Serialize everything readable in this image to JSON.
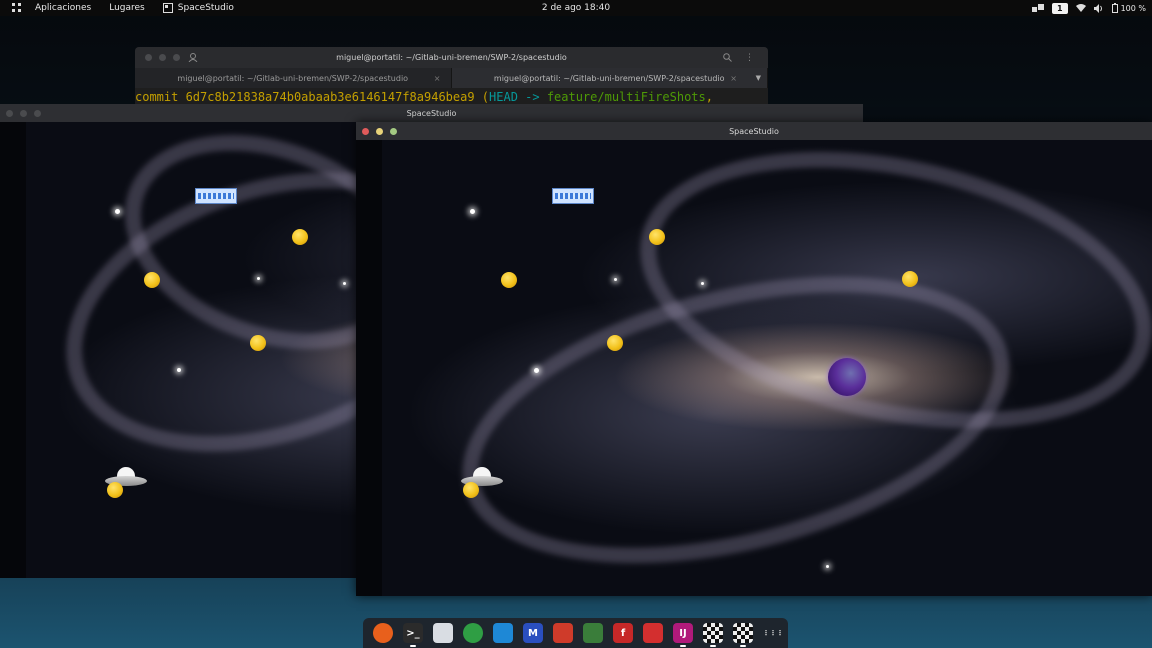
{
  "topbar": {
    "activities_icon": "app-grid-icon",
    "menus": [
      "Aplicaciones",
      "Lugares"
    ],
    "active_app": "SpaceStudio",
    "clock": "2 de ago  18:40",
    "workspace": "1",
    "battery": "100 %"
  },
  "terminal": {
    "title": "miguel@portatil: ~/Gitlab-uni-bremen/SWP-2/spacestudio",
    "tabs": [
      {
        "label": "miguel@portatil: ~/Gitlab-uni-bremen/SWP-2/spacestudio",
        "active": false
      },
      {
        "label": "miguel@portatil: ~/Gitlab-uni-bremen/SWP-2/spacestudio",
        "active": true
      }
    ],
    "tab_close": "×",
    "line": {
      "commit_word": "commit ",
      "hash": "6d7c8b21838a74b0abaab3e6146147f8a946bea9",
      "open": " (",
      "head": "HEAD -> ",
      "branch": "feature/multiFireShots",
      "tail": ","
    }
  },
  "window_back": {
    "title": "SpaceStudio"
  },
  "window_front": {
    "title": "SpaceStudio"
  },
  "colors": {
    "close": "#e05b5b",
    "minimize": "#e8d37a",
    "maximize": "#a3c982",
    "inactive_dot": "#4a4b4e"
  },
  "dock": {
    "items": [
      {
        "name": "firefox-icon",
        "glyph": "",
        "color": "#e8601c",
        "running": false
      },
      {
        "name": "terminal-icon",
        "glyph": ">_",
        "color": "#2b2b2b",
        "running": true
      },
      {
        "name": "files-icon",
        "glyph": "",
        "color": "#d9dde3",
        "running": false
      },
      {
        "name": "chrome-icon",
        "glyph": "",
        "color": "#2f9e44",
        "running": false
      },
      {
        "name": "vscode-icon",
        "glyph": "",
        "color": "#1e88d6",
        "running": false
      },
      {
        "name": "mail-icon",
        "glyph": "M",
        "color": "#2a4fbf",
        "running": false
      },
      {
        "name": "code-editor-icon",
        "glyph": "",
        "color": "#cf3b2a",
        "running": false
      },
      {
        "name": "cluster-icon",
        "glyph": "",
        "color": "#3a7d3a",
        "running": false
      },
      {
        "name": "filezilla-icon",
        "glyph": "f",
        "color": "#c62828",
        "running": false
      },
      {
        "name": "red-app-icon",
        "glyph": "",
        "color": "#d32f2f",
        "running": false
      },
      {
        "name": "intellij-icon",
        "glyph": "IJ",
        "color": "#b11a7a",
        "running": true
      },
      {
        "name": "game-window-icon",
        "glyph": "",
        "color": "#eeeeee",
        "running": true
      },
      {
        "name": "game-window-2-icon",
        "glyph": "",
        "color": "#eeeeee",
        "running": true
      },
      {
        "name": "show-apps-icon",
        "glyph": "⋮⋮⋮",
        "color": "transparent",
        "running": false
      }
    ]
  }
}
